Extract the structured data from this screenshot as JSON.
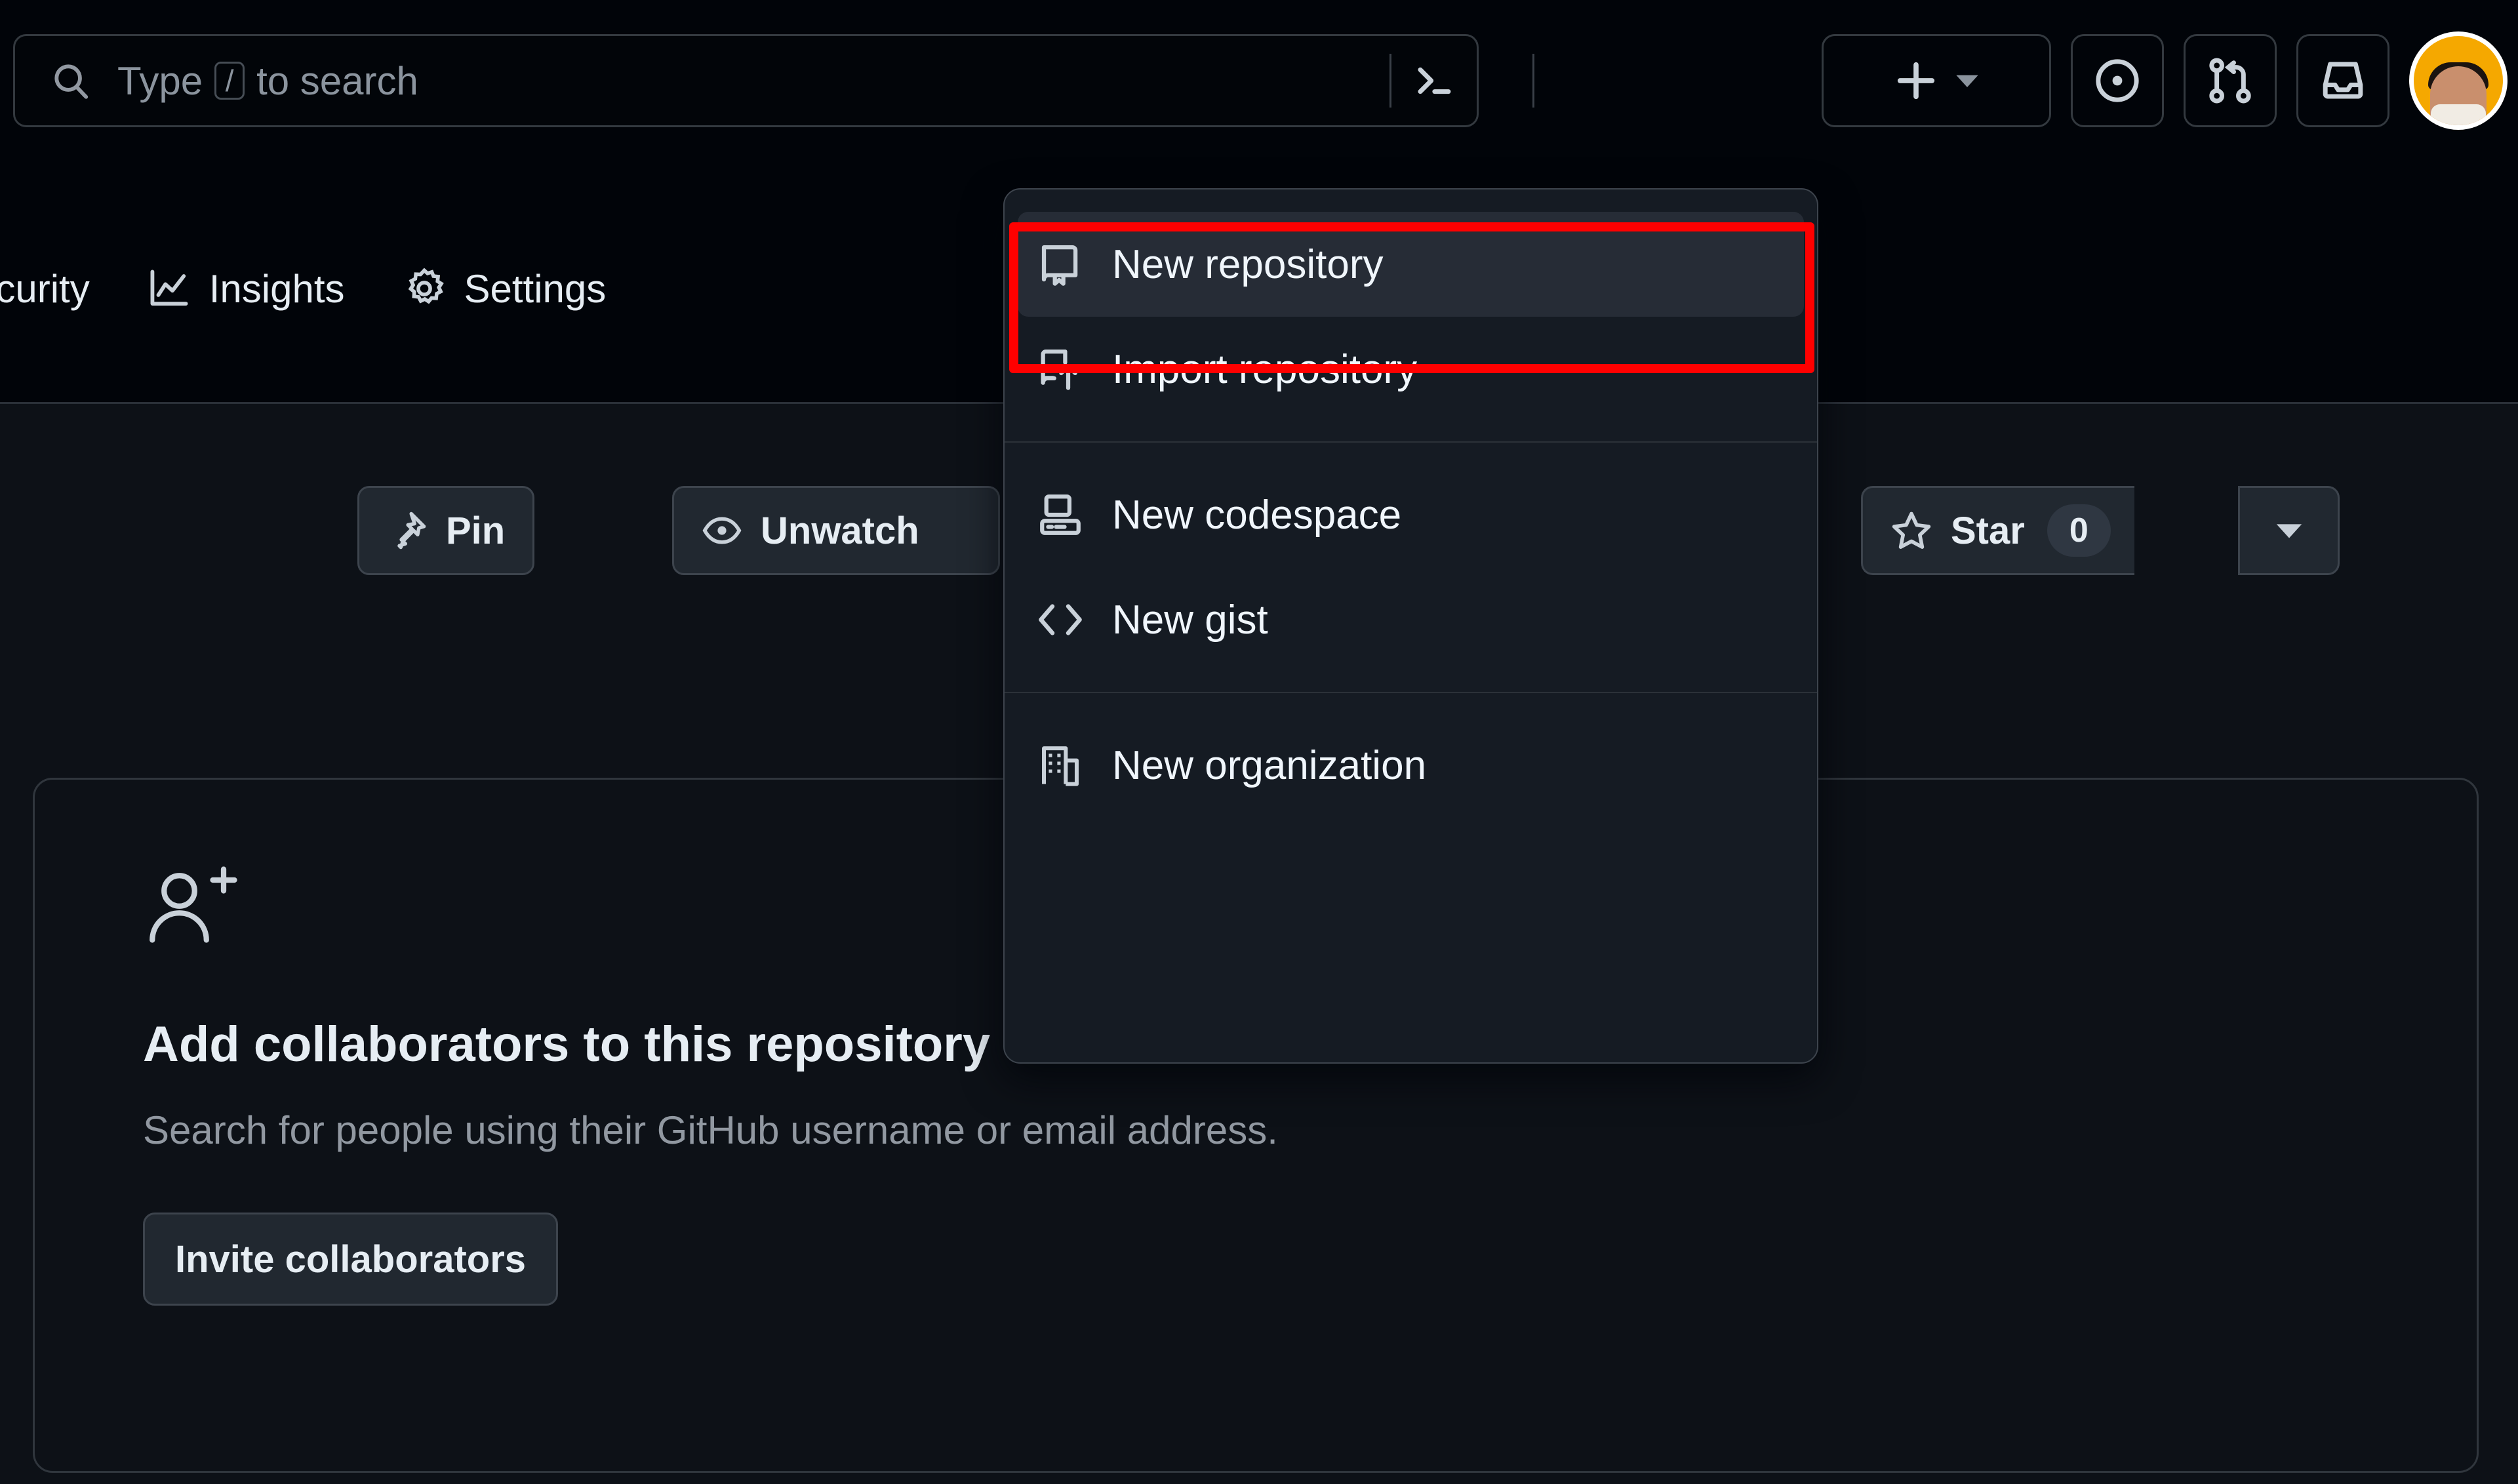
{
  "header": {
    "search": {
      "placeholder_prefix": "Type",
      "slash_key": "/",
      "placeholder_suffix": "to search",
      "terminal_icon": "terminal-icon",
      "search_icon": "search-icon"
    },
    "actions": [
      {
        "name": "create-new",
        "icon": "plus-icon",
        "caret": "triangle-down-icon",
        "label": ""
      },
      {
        "name": "issues",
        "icon": "issue-opened-icon",
        "label": ""
      },
      {
        "name": "pull-requests",
        "icon": "git-pull-request-icon",
        "label": ""
      },
      {
        "name": "notifications",
        "icon": "inbox-icon",
        "label": ""
      },
      {
        "name": "account",
        "icon": "avatar",
        "label": ""
      }
    ],
    "avatar_color": "#f5a800",
    "avatar_ring_color": "#ffffff"
  },
  "repo_nav": {
    "tabs": [
      {
        "label": "ecurity",
        "icon": "shield-icon",
        "selected": false
      },
      {
        "label": "Insights",
        "icon": "graph-icon",
        "selected": false
      },
      {
        "label": "Settings",
        "icon": "gear-icon",
        "selected": false
      }
    ]
  },
  "repo_actions": {
    "pin": {
      "label": "Pin",
      "icon": "pin-icon"
    },
    "unwatch": {
      "label": "Unwatch",
      "icon": "eye-icon"
    },
    "star": {
      "label": "Star",
      "icon": "star-icon",
      "count": "0"
    },
    "star_dropdown_icon": "triangle-down-icon"
  },
  "collaborators": {
    "icon": "person-add-icon",
    "heading": "Add collaborators to this repository",
    "subtext": "Search for people using their GitHub username or email address.",
    "invite_button_label": "Invite collaborators"
  },
  "create_new_menu": {
    "items": [
      {
        "label": "New repository",
        "icon": "repo-icon",
        "active": true
      },
      {
        "label": "Import repository",
        "icon": "repo-push-icon",
        "active": false
      },
      {
        "label": "New codespace",
        "icon": "codespaces-icon",
        "active": false
      },
      {
        "label": "New gist",
        "icon": "code-icon",
        "active": false
      },
      {
        "label": "New organization",
        "icon": "organization-icon",
        "active": false
      }
    ]
  },
  "annotation": {
    "target": "New repository",
    "color": "#ff0000"
  }
}
